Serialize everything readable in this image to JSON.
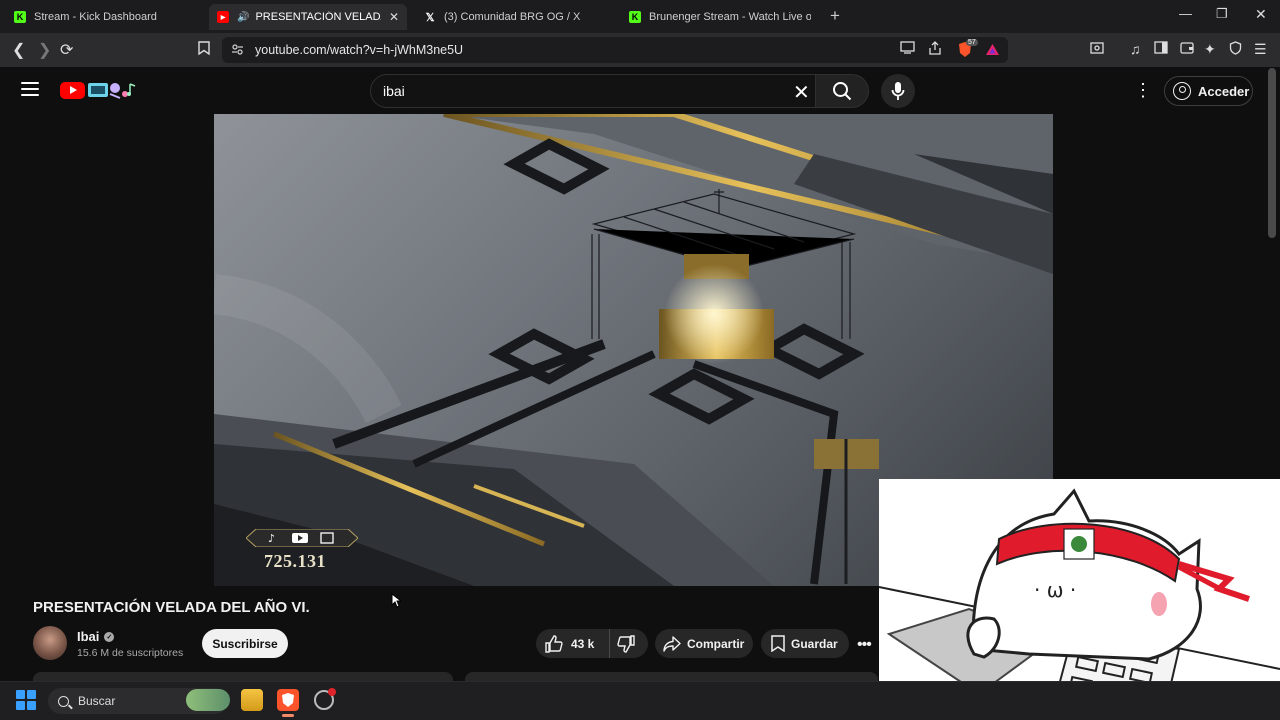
{
  "browser": {
    "tabs": [
      {
        "favicon": "kick-icon",
        "title": "Stream - Kick Dashboard",
        "active": false
      },
      {
        "favicon": "youtube-icon",
        "title": "PRESENTACIÓN VELADA DEL",
        "active": true
      },
      {
        "favicon": "x-icon",
        "title": "(3) Comunidad BRG OG / X",
        "active": false
      },
      {
        "favicon": "kick-icon",
        "title": "Brunenger Stream - Watch Live on Ki",
        "active": false
      }
    ],
    "url": "youtube.com/watch?v=h-jWhM3ne5U",
    "shields_count": "57"
  },
  "youtube": {
    "search_query": "ibai",
    "signin_label": "Acceder",
    "video": {
      "overlay_counter": "725.131",
      "title": "PRESENTACIÓN VELADA DEL AÑO VI.",
      "channel_name": "Ibai",
      "subscribers": "15.6 M de suscriptores",
      "subscribe_label": "Suscribirse",
      "likes": "43 k",
      "share_label": "Compartir",
      "save_label": "Guardar"
    }
  },
  "taskbar": {
    "search_placeholder": "Buscar"
  },
  "colors": {
    "youtube_red": "#ff0000",
    "kick_green": "#53fc18",
    "background": "#0f0f0f"
  }
}
